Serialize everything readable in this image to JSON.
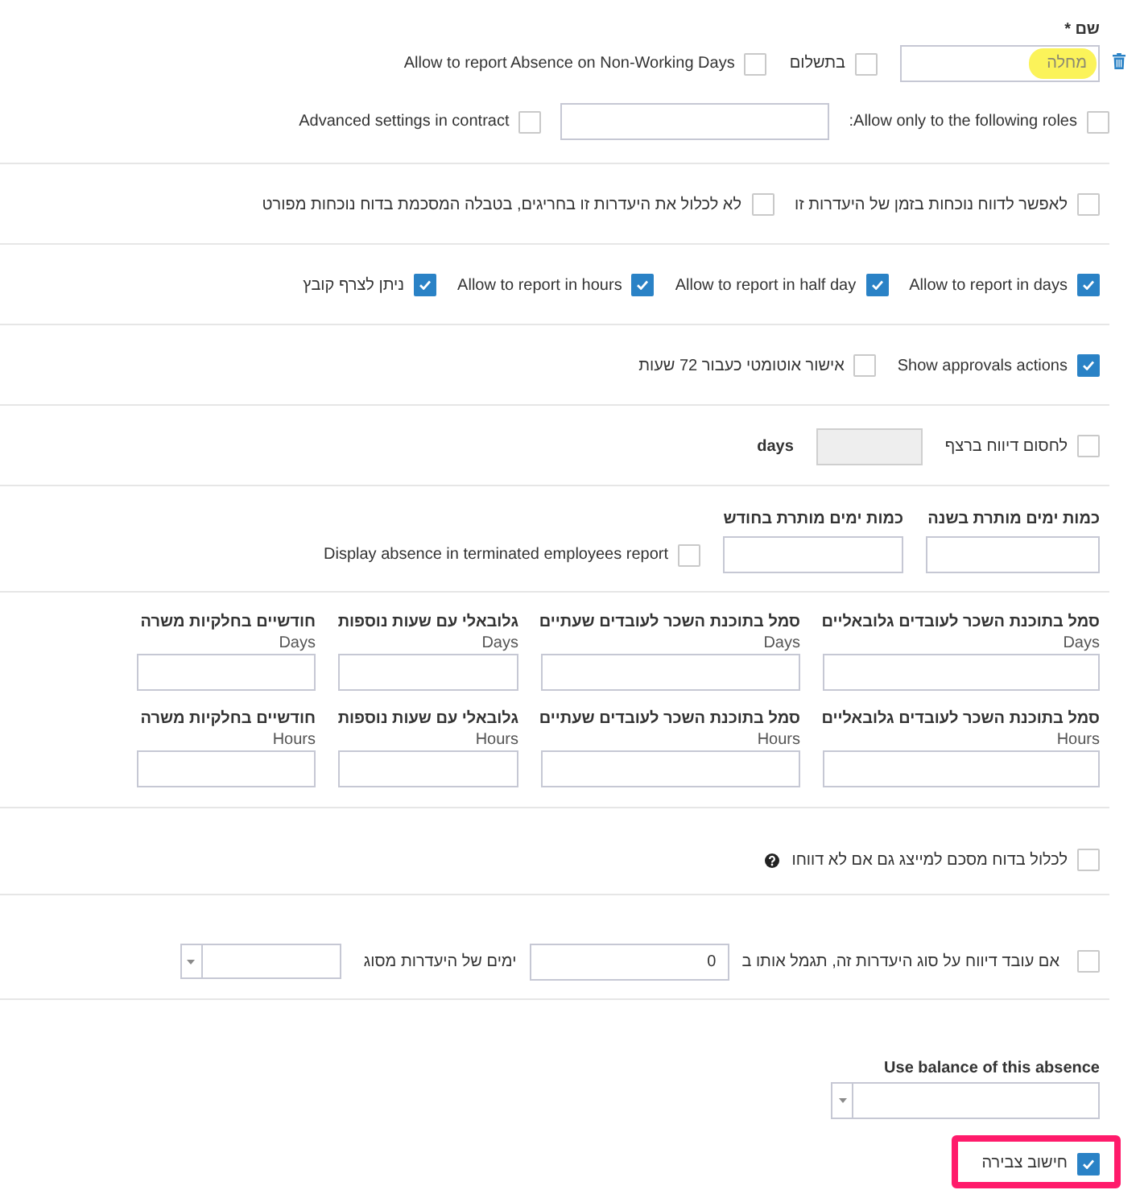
{
  "name_field": {
    "label": "שם *",
    "value": "מחלה",
    "highlighted": true
  },
  "top_options": [
    {
      "label": "בתשלום",
      "checked": false
    },
    {
      "label": "Allow to report Absence on Non-Working Days",
      "checked": false
    }
  ],
  "roles": {
    "label": "Allow only to the following roles:",
    "checked": false
  },
  "advanced_settings": {
    "label": "Advanced settings in contract",
    "checked": false
  },
  "presence_options": [
    {
      "label": "לאפשר לדווח נוכחות בזמן של היעדרות זו",
      "checked": false
    },
    {
      "label": "לא לכלול את היעדרות זו בחריגים, בטבלה המסכמת בדוח נוכחות מפורט",
      "checked": false
    }
  ],
  "report_options": [
    {
      "label": "Allow to report in days",
      "checked": true
    },
    {
      "label": "Allow to report in half day",
      "checked": true
    },
    {
      "label": "Allow to report in hours",
      "checked": true
    },
    {
      "label": "ניתן לצרף קובץ",
      "checked": true
    }
  ],
  "approval_options": [
    {
      "label": "Show approvals actions",
      "checked": true
    },
    {
      "label": "אישור אוטומטי כעבור 72 שעות",
      "checked": false
    }
  ],
  "block_consecutive": {
    "label": "לחסום דיווח ברצף",
    "checked": false,
    "input_disabled": true,
    "unit": "days"
  },
  "limits": {
    "fields": [
      {
        "label": "כמות ימים מותרת בשנה"
      },
      {
        "label": "כמות ימים מותרת בחודש"
      }
    ],
    "terminated_report": {
      "label": "Display absence in terminated employees report",
      "checked": false
    }
  },
  "payroll_codes": [
    {
      "fields": [
        {
          "label": "סמל בתוכנת השכר לעובדים גלובאליים",
          "unit": "Days"
        },
        {
          "label": "סמל בתוכנת השכר לעובדים שעתיים",
          "unit": "Days"
        },
        {
          "label": "גלובאלי עם שעות נוספות",
          "unit": "Days"
        },
        {
          "label": "חודשיים בחלקיות משרה",
          "unit": "Days"
        }
      ]
    },
    {
      "fields": [
        {
          "label": "סמל בתוכנת השכר לעובדים גלובאליים",
          "unit": "Hours"
        },
        {
          "label": "סמל בתוכנת השכר לעובדים שעתיים",
          "unit": "Hours"
        },
        {
          "label": "גלובאלי עם שעות נוספות",
          "unit": "Hours"
        },
        {
          "label": "חודשיים בחלקיות משרה",
          "unit": "Hours"
        }
      ]
    }
  ],
  "summary_report": {
    "label": "לכלול בדוח מסכם למייצג גם אם לא דווחו",
    "checked": false
  },
  "reward": {
    "label": "אם עובד דיווח על סוג היעדרות זה, תגמל אותו ב",
    "checked": false,
    "value": "0",
    "unit_label": "ימים של היעדרות מסוג"
  },
  "use_balance": {
    "label": "Use balance of this absence"
  },
  "accumulation": {
    "label": "חישוב צבירה",
    "checked": true,
    "highlighted": true
  }
}
